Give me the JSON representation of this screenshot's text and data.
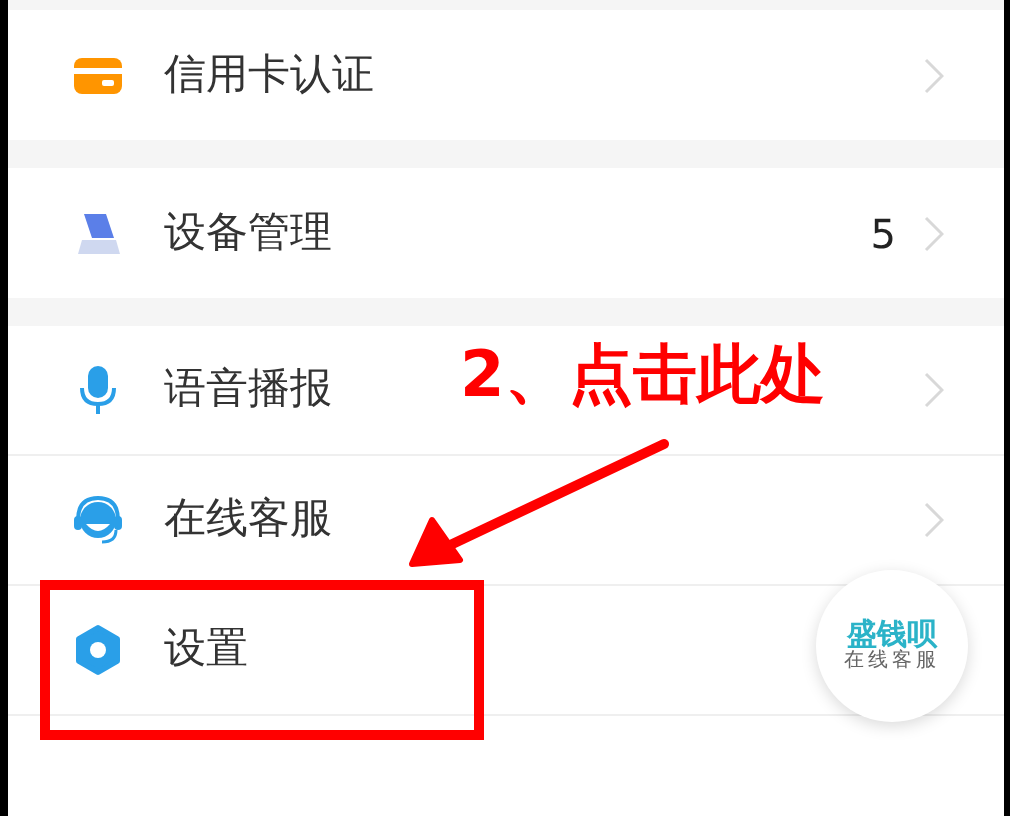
{
  "groups": [
    {
      "rows": [
        {
          "kind": "card",
          "label": "信用卡认证"
        }
      ]
    },
    {
      "rows": [
        {
          "kind": "device",
          "label": "设备管理",
          "count": "5"
        }
      ]
    },
    {
      "rows": [
        {
          "kind": "mic",
          "label": "语音播报"
        },
        {
          "kind": "headset",
          "label": "在线客服"
        },
        {
          "kind": "gear",
          "label": "设置"
        }
      ]
    }
  ],
  "floating_badge": {
    "title": "盛钱呗",
    "subtitle": "在线客服"
  },
  "annotation": {
    "text": "2、点击此处"
  }
}
